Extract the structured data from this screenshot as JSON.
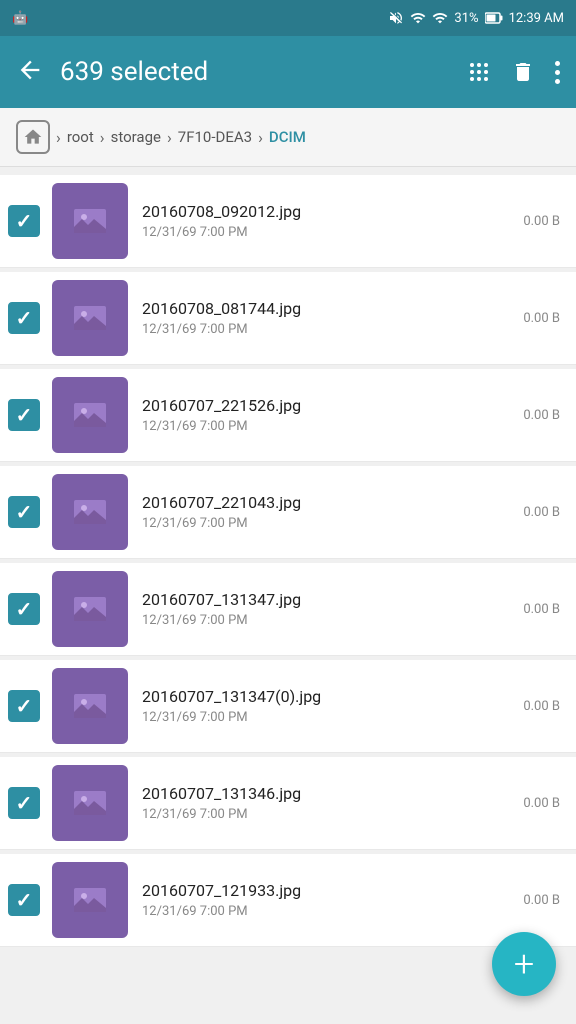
{
  "statusBar": {
    "battery": "31%",
    "time": "12:39 AM"
  },
  "appBar": {
    "title": "639 selected",
    "backLabel": "←",
    "deleteLabel": "🗑",
    "gridLabel": "grid",
    "moreLabel": "more"
  },
  "breadcrumb": {
    "homeLabel": "⌂",
    "separator": ">",
    "path": [
      "root",
      "storage",
      "7F10-DEA3"
    ],
    "active": "DCIM"
  },
  "files": [
    {
      "name": "20160708_092012.jpg",
      "date": "12/31/69 7:00 PM",
      "size": "0.00 B",
      "checked": true
    },
    {
      "name": "20160708_081744.jpg",
      "date": "12/31/69 7:00 PM",
      "size": "0.00 B",
      "checked": true
    },
    {
      "name": "20160707_221526.jpg",
      "date": "12/31/69 7:00 PM",
      "size": "0.00 B",
      "checked": true
    },
    {
      "name": "20160707_221043.jpg",
      "date": "12/31/69 7:00 PM",
      "size": "0.00 B",
      "checked": true
    },
    {
      "name": "20160707_131347.jpg",
      "date": "12/31/69 7:00 PM",
      "size": "0.00 B",
      "checked": true
    },
    {
      "name": "20160707_131347(0).jpg",
      "date": "12/31/69 7:00 PM",
      "size": "0.00 B",
      "checked": true
    },
    {
      "name": "20160707_131346.jpg",
      "date": "12/31/69 7:00 PM",
      "size": "0.00 B",
      "checked": true
    },
    {
      "name": "20160707_121933.jpg",
      "date": "12/31/69 7:00 PM",
      "size": "0.00 B",
      "checked": true
    }
  ],
  "fab": {
    "label": "+"
  }
}
